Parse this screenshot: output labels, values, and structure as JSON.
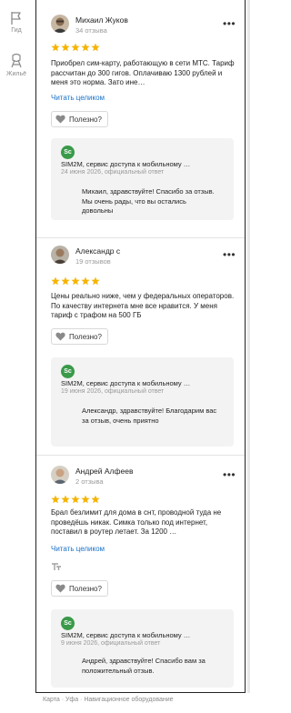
{
  "rail": {
    "items": [
      {
        "label": "Гид",
        "icon": "flag-icon"
      },
      {
        "label": "Жильё",
        "icon": "housing-icon"
      }
    ]
  },
  "reviews": [
    {
      "author": "Михаил Жуков",
      "count": "34 отзыва",
      "rating": 5,
      "text": "Приобрел сим-карту, работающую в сети МТС. Тариф рассчитан до 300 гигов. Оплачиваю 1300 рублей и меня это норма. Зато ине…",
      "read_more": "Читать целиком",
      "useful": "Полезно?",
      "reply": {
        "org_initials": "Sc",
        "org": "SIM2M, сервис доступа к мобильному …",
        "date": "24 июня 2026, официальный ответ",
        "text": "Михаил, здравствуйте! Спасибо за отзыв. Мы очень рады, что вы остались довольны"
      }
    },
    {
      "author": "Александр с",
      "count": "19 отзывов",
      "rating": 5,
      "text": "Цены реально ниже, чем у федеральных операторов. По качеству интернета мне все нравится. У меня тариф с трафом на 500 ГБ",
      "useful": "Полезно?",
      "reply": {
        "org_initials": "Sc",
        "org": "SIM2M, сервис доступа к мобильному …",
        "date": "19 июня 2026, официальный ответ",
        "text": "Александр, здравствуйте! Благодарим вас за отзыв, очень приятно"
      }
    },
    {
      "author": "Андрей Алфеев",
      "count": "2 отзыва",
      "rating": 5,
      "text": "Брал безлимит для дома в снт, проводной туда не проведёшь никак. Симка только под интернет, поставил в роутер летает. За 1200 …",
      "read_more": "Читать целиком",
      "useful": "Полезно?",
      "reply": {
        "org_initials": "Sc",
        "org": "SIM2M, сервис доступа к мобильному …",
        "date": "9 июня 2026, официальный ответ",
        "text": "Андрей, здравствуйте! Спасибо вам за положительный отзыв."
      }
    }
  ],
  "footer": {
    "crumbs": [
      "Карта",
      "Уфа",
      "Навигационное оборудование"
    ],
    "sep": "·"
  },
  "colors": {
    "star": "#f5b400",
    "link": "#1a73c8",
    "org_badge": "#3a9a4a"
  }
}
